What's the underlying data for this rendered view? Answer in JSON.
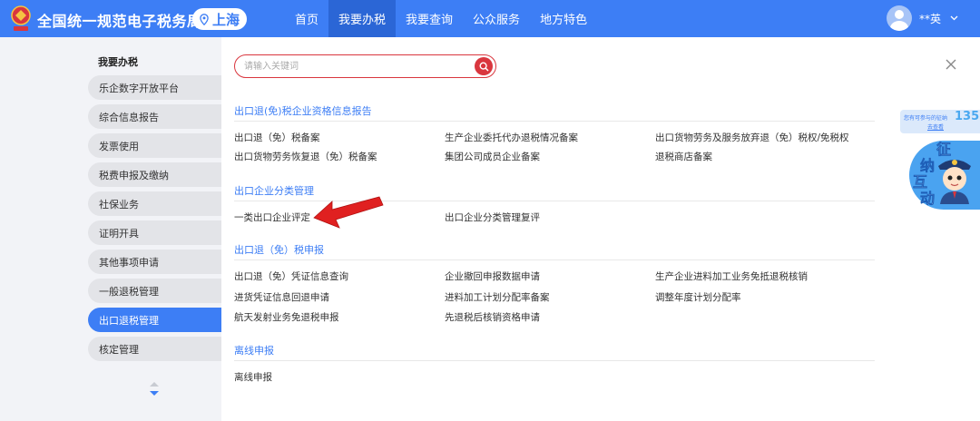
{
  "header": {
    "brand": "全国统一规范电子税务局",
    "region": "上海",
    "nav": [
      "首页",
      "我要办税",
      "我要查询",
      "公众服务",
      "地方特色"
    ],
    "active_nav": 1,
    "user_name": "**英"
  },
  "sidebar": {
    "title": "我要办税",
    "items": [
      "乐企数字开放平台",
      "综合信息报告",
      "发票使用",
      "税费申报及缴纳",
      "社保业务",
      "证明开具",
      "其他事项申请",
      "一般退税管理",
      "出口退税管理",
      "核定管理"
    ],
    "active_index": 8
  },
  "search": {
    "placeholder": "请输入关键词"
  },
  "sections": [
    {
      "title": "出口退(免)税企业资格信息报告",
      "items": [
        "出口退（免）税备案",
        "生产企业委托代办退税情况备案",
        "出口货物劳务及服务放弃退（免）税权/免税权",
        "出口货物劳务恢复退（免）税备案",
        "集团公司成员企业备案",
        "退税商店备案"
      ]
    },
    {
      "title": "出口企业分类管理",
      "items": [
        "一类出口企业评定",
        "出口企业分类管理复评"
      ]
    },
    {
      "title": "出口退（免）税申报",
      "items": [
        "出口退（免）凭证信息查询",
        "企业撤回申报数据申请",
        "生产企业进料加工业务免抵退税核销",
        "进货凭证信息回退申请",
        "进料加工计划分配率备案",
        "调整年度计划分配率",
        "航天发射业务免退税申报",
        "先退税后核销资格申请"
      ]
    },
    {
      "title": "离线申报",
      "items": [
        "离线申报"
      ]
    }
  ],
  "float_widget": {
    "top_text": "您有可参与的征纳",
    "link": "去查看",
    "count": "135",
    "chars": [
      "征",
      "纳",
      "互",
      "动"
    ]
  },
  "colors": {
    "primary": "#3d7ef5",
    "nav_active": "#2b66d6",
    "search_red": "#d9363e",
    "arrow_red": "#e02020"
  }
}
